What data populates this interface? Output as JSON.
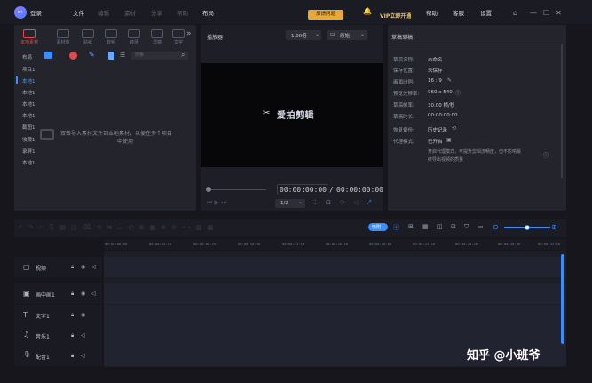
{
  "topbar": {
    "login": "登录",
    "menu": [
      "文件",
      "编辑",
      "素材",
      "分享",
      "帮助"
    ],
    "project": "布局",
    "feedback": "反馈问题",
    "vip": "VIP立即开通",
    "links": [
      "帮助",
      "客服",
      "设置"
    ]
  },
  "media": {
    "tools": [
      {
        "label": "本地素材",
        "active": true
      },
      {
        "label": "素材库",
        "active": false
      },
      {
        "label": "贴纸",
        "active": false
      },
      {
        "label": "音频",
        "active": false
      },
      {
        "label": "转场",
        "active": false
      },
      {
        "label": "滤镜",
        "active": false
      },
      {
        "label": "文字",
        "active": false
      }
    ],
    "folder_header": "布局",
    "search_placeholder": "搜索",
    "tree": [
      "项目1",
      "本地1",
      "本地1",
      "本地1",
      "本地1",
      "截图1",
      "收藏1",
      "录屏1",
      "本地1"
    ],
    "empty_hint_line1": "双击导入素材文件到本地素材，以便在多个项目",
    "empty_hint_line2": "中使用"
  },
  "player": {
    "title": "播放器",
    "speed": "1.00倍",
    "ratio": "原始",
    "watermark": "爱拍剪辑",
    "time_current": "00:00:00:00",
    "time_sep": "/",
    "time_total": "00:00:00:00",
    "quality": "1/2"
  },
  "draft": {
    "title": "草稿草稿",
    "props": [
      {
        "label": "草稿名称:",
        "value": "未命名"
      },
      {
        "label": "保存位置:",
        "value": "未保存"
      },
      {
        "label": "画面比例:",
        "value": "16 : 9"
      },
      {
        "label": "预览分辨率:",
        "value": "960 x 540"
      },
      {
        "label": "草稿帧率:",
        "value": "30.00 帧/秒"
      },
      {
        "label": "草稿时长:",
        "value": "00:00:00:00"
      },
      {
        "label": "恢复备份:",
        "value": "历史记录"
      },
      {
        "label": "代理模式:",
        "value": "已开启"
      }
    ],
    "proxy_desc_line1": "开启代理模式，可提升剪辑流畅度，但不影响最",
    "proxy_desc_line2": "终导出视频的质量"
  },
  "timeline": {
    "toggle_label": "吸附",
    "ruler": [
      "00:00:00:00",
      "00:00:03:15",
      "00:00:06:25",
      "00:00:10:00",
      "00:00:13:10",
      "00:00:16:20",
      "00:00:20:00",
      "00:00:23:10",
      "00:00:26:20",
      "00:00:30:00",
      "00:00:33:10"
    ],
    "tracks": [
      {
        "name": "视频",
        "icon": "video-track-icon",
        "glyph": "▢"
      },
      {
        "name": "画中画1",
        "icon": "pip-track-icon",
        "glyph": "▣"
      },
      {
        "name": "文字1",
        "icon": "text-track-icon",
        "glyph": "T"
      },
      {
        "name": "音乐1",
        "icon": "music-track-icon",
        "glyph": "♫"
      },
      {
        "name": "配音1",
        "icon": "voice-track-icon",
        "glyph": "🎙"
      }
    ]
  },
  "watermark_text": "知乎 @小班爷",
  "colors": {
    "accent": "#3a8dff",
    "active_red": "#e04a4a",
    "feedback": "#e9a93a"
  }
}
